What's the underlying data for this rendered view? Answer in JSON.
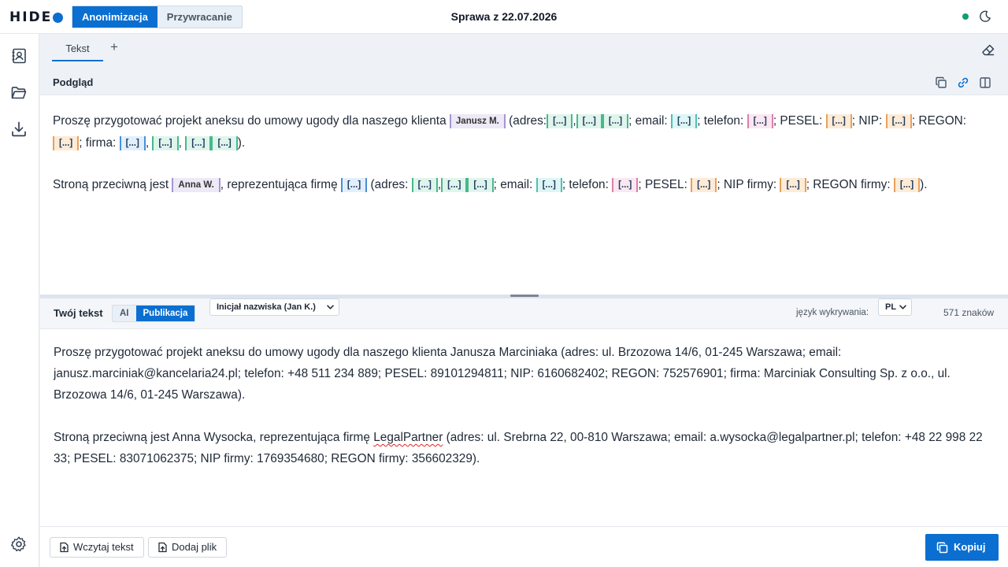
{
  "app": {
    "logo_text": "HIDE"
  },
  "modes": {
    "anonymize": "Anonimizacja",
    "restore": "Przywracanie"
  },
  "case_title": "Sprawa z 22.07.2026",
  "tabs": {
    "text_tab": "Tekst",
    "add": "+"
  },
  "preview": {
    "title": "Podgląd",
    "placeholder_token": "[...]",
    "paragraph1": {
      "t0": "Proszę przygotować projekt aneksu do umowy ugody dla naszego klienta",
      "name": "Janusz M.",
      "t1": "(adres:",
      "sep_comma": ",",
      "t2": "; email:",
      "t3": "; telefon:",
      "t4": "; PESEL:",
      "t5": "; NIP:",
      "t6": "; REGON:",
      "t7": "; firma:",
      "t8": ")."
    },
    "paragraph2": {
      "t0": "Stroną przeciwną jest",
      "name": "Anna W.",
      "t1": ", reprezentująca firmę",
      "t2": "(adres:",
      "t3": "; email:",
      "t4": "; telefon:",
      "t5": "; PESEL:",
      "t6": "; NIP firmy:",
      "t7": "; REGON firmy:",
      "t8": ")."
    }
  },
  "your_text": {
    "title": "Twój tekst",
    "mode_ai": "AI",
    "mode_publication": "Publikacja",
    "surname_format": "Inicjał nazwiska (Jan K.)",
    "detection_language_label": "język wykrywania:",
    "detection_language": "PL",
    "char_count": "571 znaków",
    "paragraph1": "Proszę przygotować projekt aneksu do umowy ugody dla naszego klienta Janusza Marciniaka (adres: ul. Brzozowa 14/6, 01-245 Warszawa; email: janusz.marciniak@kancelaria24.pl; telefon: +48 511 234 889; PESEL: 89101294811; NIP: 6160682402; REGON: 752576901; firma: Marciniak Consulting Sp. z o.o., ul. Brzozowa 14/6, 01-245 Warszawa).",
    "paragraph2_before": "Stroną przeciwną jest Anna Wysocka, reprezentująca firmę ",
    "paragraph2_flagged": "LegalPartner",
    "paragraph2_after": " (adres: ul. Srebrna 22, 00-810 Warszawa; email: a.wysocka@legalpartner.pl; telefon: +48 22 998 22 33; PESEL: 83071062375; NIP firmy: 1769354680; REGON firmy: 356602329)."
  },
  "bottom": {
    "load_text": "Wczytaj tekst",
    "add_file": "Dodaj plik",
    "copy": "Kopiuj"
  },
  "colors": {
    "accent": "#0a6fd0",
    "status_online": "#0e9f6e"
  },
  "icons": [
    "theme-moon-icon",
    "contacts-icon",
    "folder-icon",
    "download-icon",
    "settings-gear-icon",
    "eraser-icon",
    "copy-icon",
    "link-icon",
    "split-view-icon",
    "chevron-down-icon",
    "file-upload-icon"
  ]
}
